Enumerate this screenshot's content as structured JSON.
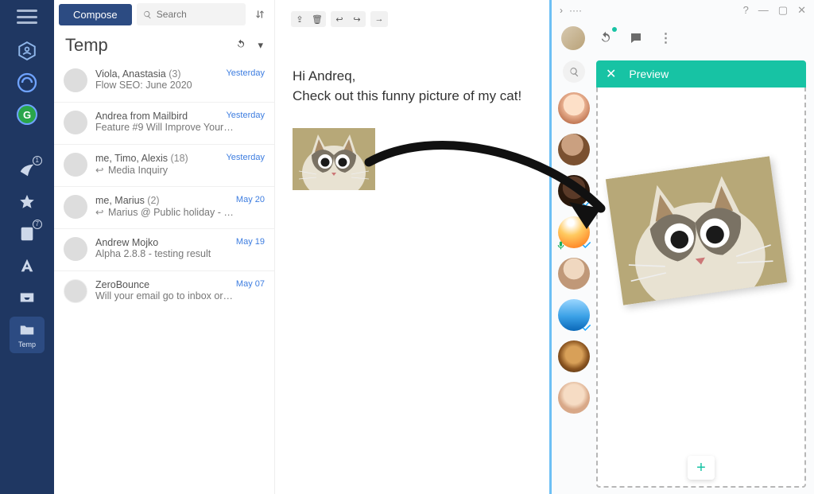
{
  "rail": {
    "items": [
      {
        "name": "hamburger-icon"
      },
      {
        "name": "home-hex-icon"
      },
      {
        "name": "mailbird-ring-icon"
      },
      {
        "name": "google-icon",
        "label": "G"
      },
      {
        "name": "wing-icon",
        "badge": "1"
      },
      {
        "name": "star-icon"
      },
      {
        "name": "note-icon",
        "badge": "7"
      },
      {
        "name": "aa-icon"
      },
      {
        "name": "inbox-icon"
      },
      {
        "name": "temp-folder-icon",
        "label": "Temp",
        "selected": true
      }
    ]
  },
  "compose_label": "Compose",
  "search_placeholder": "Search",
  "folder": {
    "name": "Temp"
  },
  "emails": [
    {
      "from": "Viola, Anastasia",
      "count": "(3)",
      "subject": "Flow SEO: June 2020",
      "date": "Yesterday",
      "reply": false,
      "avatar": "avA"
    },
    {
      "from": "Andrea from Mailbird",
      "count": "",
      "subject": "Feature #9 Will Improve Your…",
      "date": "Yesterday",
      "reply": false,
      "avatar": "avB"
    },
    {
      "from": "me, Timo, Alexis",
      "count": "(18)",
      "subject": "Media Inquiry",
      "date": "Yesterday",
      "reply": true,
      "avatar": "avC"
    },
    {
      "from": "me, Marius",
      "count": "(2)",
      "subject": "Marius @ Public holiday - 1st…",
      "date": "May 20",
      "reply": true,
      "avatar": "avD"
    },
    {
      "from": "Andrew Mojko",
      "count": "",
      "subject": "Alpha 2.8.8 - testing result",
      "date": "May 19",
      "reply": false,
      "avatar": "avB"
    },
    {
      "from": "ZeroBounce",
      "count": "",
      "subject": "Will your email go to inbox or sp…",
      "date": "May 07",
      "reply": false,
      "avatar": "avF"
    }
  ],
  "message": {
    "line1": "Hi Andreq,",
    "line2": "Check out this funny picture of my cat!"
  },
  "whereby": {
    "title_dots": "····",
    "help": "?",
    "preview_label": "Preview",
    "people": [
      {
        "cls": "p1",
        "check": false,
        "mic": false
      },
      {
        "cls": "p2",
        "check": false,
        "mic": false
      },
      {
        "cls": "p3",
        "check": true,
        "mic": false
      },
      {
        "cls": "p4",
        "check": true,
        "mic": true
      },
      {
        "cls": "p5",
        "check": false,
        "mic": false
      },
      {
        "cls": "p6",
        "check": true,
        "mic": false
      },
      {
        "cls": "p7",
        "check": false,
        "mic": false
      },
      {
        "cls": "p8",
        "check": false,
        "mic": false
      }
    ],
    "float_plus": "+"
  }
}
